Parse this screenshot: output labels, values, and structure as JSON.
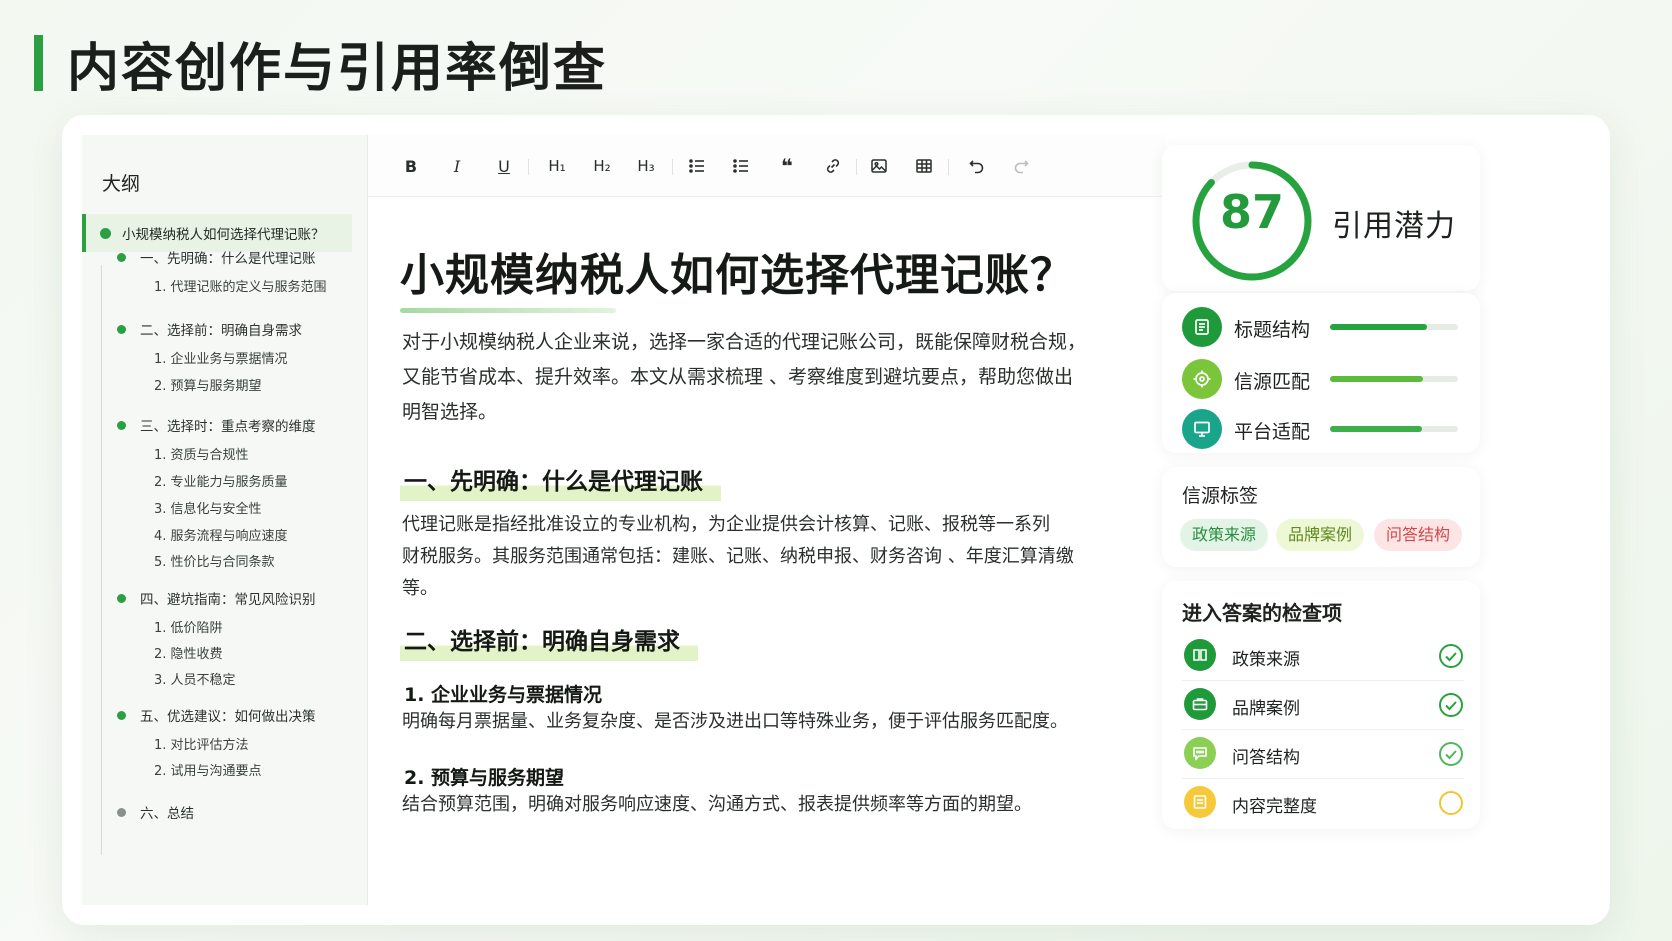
{
  "page": {
    "title": "内容创作与引用率倒查"
  },
  "outline": {
    "title": "大纲",
    "active": "小规模纳税人如何选择代理记账？",
    "items": [
      {
        "type": "sec",
        "label": "一、先明确：什么是代理记账"
      },
      {
        "type": "sub",
        "label": "1. 代理记账的定义与服务范围"
      },
      {
        "type": "sec",
        "label": "二、选择前：明确自身需求"
      },
      {
        "type": "sub",
        "label": "1. 企业业务与票据情况"
      },
      {
        "type": "sub",
        "label": "2. 预算与服务期望"
      },
      {
        "type": "sec",
        "label": "三、选择时：重点考察的维度"
      },
      {
        "type": "sub",
        "label": "1. 资质与合规性"
      },
      {
        "type": "sub",
        "label": "2. 专业能力与服务质量"
      },
      {
        "type": "sub",
        "label": "3. 信息化与安全性"
      },
      {
        "type": "sub",
        "label": "4. 服务流程与响应速度"
      },
      {
        "type": "sub",
        "label": "5. 性价比与合同条款"
      },
      {
        "type": "sec",
        "label": "四、避坑指南：常见风险识别"
      },
      {
        "type": "sub",
        "label": "1. 低价陷阱"
      },
      {
        "type": "sub",
        "label": "2. 隐性收费"
      },
      {
        "type": "sub",
        "label": "3. 人员不稳定"
      },
      {
        "type": "sec",
        "label": "五、优选建议：如何做出决策"
      },
      {
        "type": "sub",
        "label": "1. 对比评估方法"
      },
      {
        "type": "sub",
        "label": "2. 试用与沟通要点"
      },
      {
        "type": "sec-gray",
        "label": "六、总结"
      }
    ]
  },
  "toolbar": {
    "bold": "B",
    "italic": "I",
    "underline": "U",
    "h1": "H₁",
    "h2": "H₂",
    "h3": "H₃"
  },
  "doc": {
    "title": "小规模纳税人如何选择代理记账？",
    "intro_1": "对于小规模纳税人企业来说，选择一家合适的代理记账公司，既能保障财税合规，",
    "intro_2": "又能节省成本、提升效率。本文从需求梳理 、考察维度到避坑要点，帮助您做出",
    "intro_3": "明智选择。",
    "h2_1": "一、先明确：什么是代理记账",
    "p1_1": "代理记账是指经批准设立的专业机构，为企业提供会计核算、记账、报税等一系列",
    "p1_2": "财税服务。其服务范围通常包括：建账、记账、纳税申报、财务咨询 、年度汇算清缴",
    "p1_3": "等。",
    "h2_2": "二、选择前：明确自身需求",
    "h3_1": "1. 企业业务与票据情况",
    "p2": "明确每月票据量、业务复杂度、是否涉及进出口等特殊业务，便于评估服务匹配度。",
    "h3_2": "2. 预算与服务期望",
    "p3": "结合预算范围，明确对服务响应速度、沟通方式、报表提供频率等方面的期望。"
  },
  "score": {
    "value": "87",
    "label": "引用潜力",
    "percent": 87
  },
  "metrics": [
    {
      "label": "标题结构",
      "percent": 76,
      "icon": "document-list-icon",
      "color": "#1f9a3a"
    },
    {
      "label": "信源匹配",
      "percent": 73,
      "icon": "target-icon",
      "color": "#7ac53a"
    },
    {
      "label": "平台适配",
      "percent": 72,
      "icon": "monitor-icon",
      "color": "#1aa58a"
    }
  ],
  "tags": {
    "title": "信源标签",
    "items": [
      {
        "label": "政策来源",
        "bg": "#e3f4e6",
        "fg": "#2a8f42"
      },
      {
        "label": "品牌案例",
        "bg": "#eef7d6",
        "fg": "#5d8a1c"
      },
      {
        "label": "问答结构",
        "bg": "#fde5e5",
        "fg": "#d24848"
      }
    ]
  },
  "checks": {
    "title": "进入答案的检查项",
    "items": [
      {
        "label": "政策来源",
        "status": "done",
        "icon": "book-icon",
        "color": "#1f9a3a"
      },
      {
        "label": "品牌案例",
        "status": "done",
        "icon": "briefcase-icon",
        "color": "#1f9a3a"
      },
      {
        "label": "问答结构",
        "status": "done",
        "icon": "chat-icon",
        "color": "#8bcf55"
      },
      {
        "label": "内容完整度",
        "status": "pending",
        "icon": "list-icon",
        "color": "#f5c93a"
      }
    ]
  }
}
